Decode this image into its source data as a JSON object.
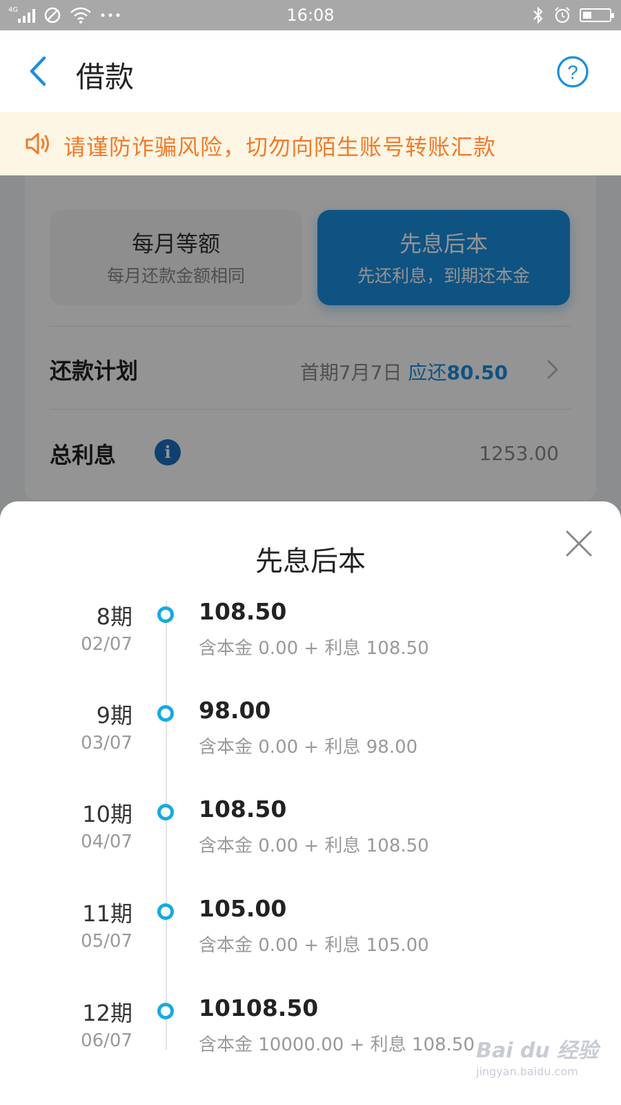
{
  "status_bar": {
    "network": "4G",
    "time": "16:08",
    "battery_level": 0.3
  },
  "header": {
    "title": "借款"
  },
  "notice": {
    "text": "请谨防诈骗风险，切勿向陌生账号转账汇款"
  },
  "repayment_options": [
    {
      "title": "每月等额",
      "subtitle": "每月还款金额相同",
      "selected": false
    },
    {
      "title": "先息后本",
      "subtitle": "先还利息，到期还本金",
      "selected": true
    }
  ],
  "plan": {
    "label": "还款计划",
    "first_period": "首期7月7日",
    "due_label": "应还",
    "due_value": "80.50"
  },
  "interest": {
    "label": "总利息",
    "value": "1253.00"
  },
  "sheet": {
    "title": "先息后本",
    "items": [
      {
        "period": "8期",
        "date": "02/07",
        "amount": "108.50",
        "detail": "含本金 0.00 + 利息 108.50"
      },
      {
        "period": "9期",
        "date": "03/07",
        "amount": "98.00",
        "detail": "含本金 0.00 + 利息 98.00"
      },
      {
        "period": "10期",
        "date": "04/07",
        "amount": "108.50",
        "detail": "含本金 0.00 + 利息 108.50"
      },
      {
        "period": "11期",
        "date": "05/07",
        "amount": "105.00",
        "detail": "含本金 0.00 + 利息 105.00"
      },
      {
        "period": "12期",
        "date": "06/07",
        "amount": "10108.50",
        "detail": "含本金 10000.00 + 利息 108.50"
      }
    ]
  },
  "watermark": {
    "main": "Bai du 经验",
    "sub": "jingyan.baidu.com"
  },
  "colors": {
    "accent": "#1a8fe0",
    "notice_text": "#f37a2a",
    "notice_bg": "#fdf6e4",
    "timeline_dot": "#17a8e6"
  }
}
